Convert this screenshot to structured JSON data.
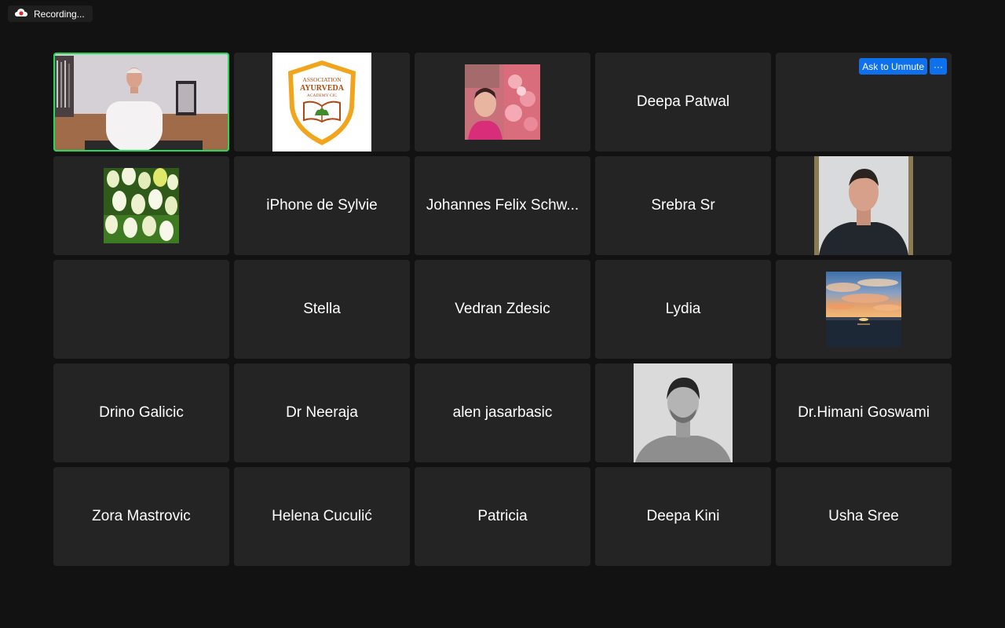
{
  "recording": {
    "label": "Recording..."
  },
  "tiles": [
    {
      "name": ""
    },
    {
      "logo_text": [
        "ASSOCIATION",
        "AYURVEDA",
        "ACADEMY CIC"
      ]
    },
    {
      "name": ""
    },
    {
      "name": "Deepa Patwal"
    },
    {
      "name": "",
      "ask_unmute_label": "Ask to Unmute",
      "more_label": "···"
    },
    {
      "name": ""
    },
    {
      "name": "iPhone de Sylvie"
    },
    {
      "name": "Johannes Felix Schw..."
    },
    {
      "name": "Srebra Sr"
    },
    {
      "name": ""
    },
    {
      "name": ""
    },
    {
      "name": "Stella"
    },
    {
      "name": "Vedran Zdesic"
    },
    {
      "name": "Lydia"
    },
    {
      "name": ""
    },
    {
      "name": "Drino Galicic"
    },
    {
      "name": "Dr Neeraja"
    },
    {
      "name": "alen jasarbasic"
    },
    {
      "name": ""
    },
    {
      "name": "Dr.Himani Goswami"
    },
    {
      "name": "Zora Mastrovic"
    },
    {
      "name": "Helena Cuculić"
    },
    {
      "name": "Patricia"
    },
    {
      "name": "Deepa Kini"
    },
    {
      "name": "Usha Sree"
    }
  ],
  "colors": {
    "active_speaker": "#23d959",
    "button_blue": "#0e71eb",
    "tile_bg": "#242424",
    "background": "#121212"
  }
}
